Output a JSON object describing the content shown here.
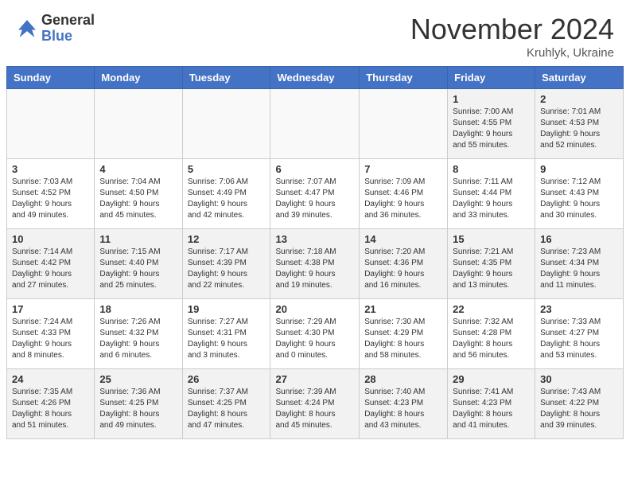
{
  "header": {
    "logo": {
      "general": "General",
      "blue": "Blue"
    },
    "title": "November 2024",
    "location": "Kruhlyk, Ukraine"
  },
  "weekdays": [
    "Sunday",
    "Monday",
    "Tuesday",
    "Wednesday",
    "Thursday",
    "Friday",
    "Saturday"
  ],
  "weeks": [
    [
      {
        "day": "",
        "info": ""
      },
      {
        "day": "",
        "info": ""
      },
      {
        "day": "",
        "info": ""
      },
      {
        "day": "",
        "info": ""
      },
      {
        "day": "",
        "info": ""
      },
      {
        "day": "1",
        "info": "Sunrise: 7:00 AM\nSunset: 4:55 PM\nDaylight: 9 hours\nand 55 minutes."
      },
      {
        "day": "2",
        "info": "Sunrise: 7:01 AM\nSunset: 4:53 PM\nDaylight: 9 hours\nand 52 minutes."
      }
    ],
    [
      {
        "day": "3",
        "info": "Sunrise: 7:03 AM\nSunset: 4:52 PM\nDaylight: 9 hours\nand 49 minutes."
      },
      {
        "day": "4",
        "info": "Sunrise: 7:04 AM\nSunset: 4:50 PM\nDaylight: 9 hours\nand 45 minutes."
      },
      {
        "day": "5",
        "info": "Sunrise: 7:06 AM\nSunset: 4:49 PM\nDaylight: 9 hours\nand 42 minutes."
      },
      {
        "day": "6",
        "info": "Sunrise: 7:07 AM\nSunset: 4:47 PM\nDaylight: 9 hours\nand 39 minutes."
      },
      {
        "day": "7",
        "info": "Sunrise: 7:09 AM\nSunset: 4:46 PM\nDaylight: 9 hours\nand 36 minutes."
      },
      {
        "day": "8",
        "info": "Sunrise: 7:11 AM\nSunset: 4:44 PM\nDaylight: 9 hours\nand 33 minutes."
      },
      {
        "day": "9",
        "info": "Sunrise: 7:12 AM\nSunset: 4:43 PM\nDaylight: 9 hours\nand 30 minutes."
      }
    ],
    [
      {
        "day": "10",
        "info": "Sunrise: 7:14 AM\nSunset: 4:42 PM\nDaylight: 9 hours\nand 27 minutes."
      },
      {
        "day": "11",
        "info": "Sunrise: 7:15 AM\nSunset: 4:40 PM\nDaylight: 9 hours\nand 25 minutes."
      },
      {
        "day": "12",
        "info": "Sunrise: 7:17 AM\nSunset: 4:39 PM\nDaylight: 9 hours\nand 22 minutes."
      },
      {
        "day": "13",
        "info": "Sunrise: 7:18 AM\nSunset: 4:38 PM\nDaylight: 9 hours\nand 19 minutes."
      },
      {
        "day": "14",
        "info": "Sunrise: 7:20 AM\nSunset: 4:36 PM\nDaylight: 9 hours\nand 16 minutes."
      },
      {
        "day": "15",
        "info": "Sunrise: 7:21 AM\nSunset: 4:35 PM\nDaylight: 9 hours\nand 13 minutes."
      },
      {
        "day": "16",
        "info": "Sunrise: 7:23 AM\nSunset: 4:34 PM\nDaylight: 9 hours\nand 11 minutes."
      }
    ],
    [
      {
        "day": "17",
        "info": "Sunrise: 7:24 AM\nSunset: 4:33 PM\nDaylight: 9 hours\nand 8 minutes."
      },
      {
        "day": "18",
        "info": "Sunrise: 7:26 AM\nSunset: 4:32 PM\nDaylight: 9 hours\nand 6 minutes."
      },
      {
        "day": "19",
        "info": "Sunrise: 7:27 AM\nSunset: 4:31 PM\nDaylight: 9 hours\nand 3 minutes."
      },
      {
        "day": "20",
        "info": "Sunrise: 7:29 AM\nSunset: 4:30 PM\nDaylight: 9 hours\nand 0 minutes."
      },
      {
        "day": "21",
        "info": "Sunrise: 7:30 AM\nSunset: 4:29 PM\nDaylight: 8 hours\nand 58 minutes."
      },
      {
        "day": "22",
        "info": "Sunrise: 7:32 AM\nSunset: 4:28 PM\nDaylight: 8 hours\nand 56 minutes."
      },
      {
        "day": "23",
        "info": "Sunrise: 7:33 AM\nSunset: 4:27 PM\nDaylight: 8 hours\nand 53 minutes."
      }
    ],
    [
      {
        "day": "24",
        "info": "Sunrise: 7:35 AM\nSunset: 4:26 PM\nDaylight: 8 hours\nand 51 minutes."
      },
      {
        "day": "25",
        "info": "Sunrise: 7:36 AM\nSunset: 4:25 PM\nDaylight: 8 hours\nand 49 minutes."
      },
      {
        "day": "26",
        "info": "Sunrise: 7:37 AM\nSunset: 4:25 PM\nDaylight: 8 hours\nand 47 minutes."
      },
      {
        "day": "27",
        "info": "Sunrise: 7:39 AM\nSunset: 4:24 PM\nDaylight: 8 hours\nand 45 minutes."
      },
      {
        "day": "28",
        "info": "Sunrise: 7:40 AM\nSunset: 4:23 PM\nDaylight: 8 hours\nand 43 minutes."
      },
      {
        "day": "29",
        "info": "Sunrise: 7:41 AM\nSunset: 4:23 PM\nDaylight: 8 hours\nand 41 minutes."
      },
      {
        "day": "30",
        "info": "Sunrise: 7:43 AM\nSunset: 4:22 PM\nDaylight: 8 hours\nand 39 minutes."
      }
    ]
  ]
}
